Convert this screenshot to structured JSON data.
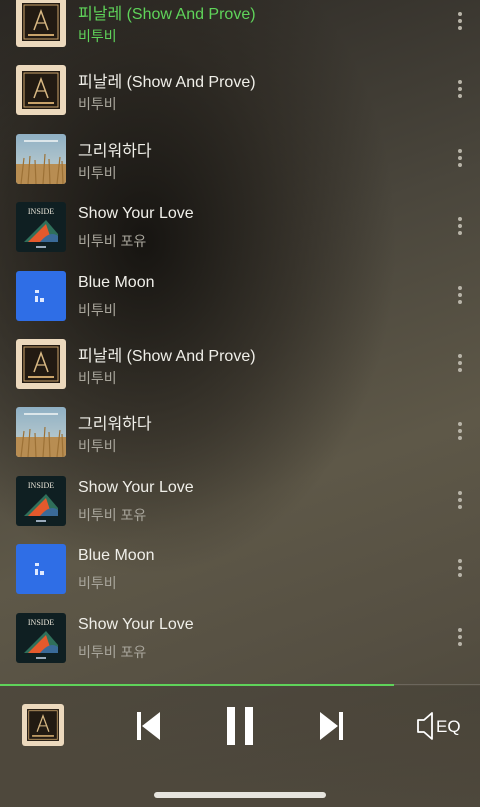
{
  "playlist": {
    "items": [
      {
        "title": "피날레 (Show And Prove)",
        "artist": "비투비",
        "art": "finale",
        "active": true
      },
      {
        "title": "피날레 (Show And Prove)",
        "artist": "비투비",
        "art": "finale",
        "active": false
      },
      {
        "title": "그리워하다",
        "artist": "비투비",
        "art": "missing",
        "active": false
      },
      {
        "title": "Show Your Love",
        "artist": "비투비 포유",
        "art": "inside",
        "active": false
      },
      {
        "title": "Blue Moon",
        "artist": "비투비",
        "art": "bluemoon",
        "active": false
      },
      {
        "title": "피날레 (Show And Prove)",
        "artist": "비투비",
        "art": "finale",
        "active": false
      },
      {
        "title": "그리워하다",
        "artist": "비투비",
        "art": "missing",
        "active": false
      },
      {
        "title": "Show Your Love",
        "artist": "비투비 포유",
        "art": "inside",
        "active": false
      },
      {
        "title": "Blue Moon",
        "artist": "비투비",
        "art": "bluemoon",
        "active": false
      },
      {
        "title": "Show Your Love",
        "artist": "비투비 포유",
        "art": "inside",
        "active": false
      }
    ]
  },
  "player": {
    "progress": 0.82,
    "controls": {
      "previous_icon": "skip-previous-icon",
      "pause_icon": "pause-icon",
      "next_icon": "skip-next-icon",
      "eq_label": "EQ"
    }
  },
  "colors": {
    "accent": "#5fd35a",
    "title_text": "#f0efe9",
    "artist_text": "#a9a69c"
  }
}
